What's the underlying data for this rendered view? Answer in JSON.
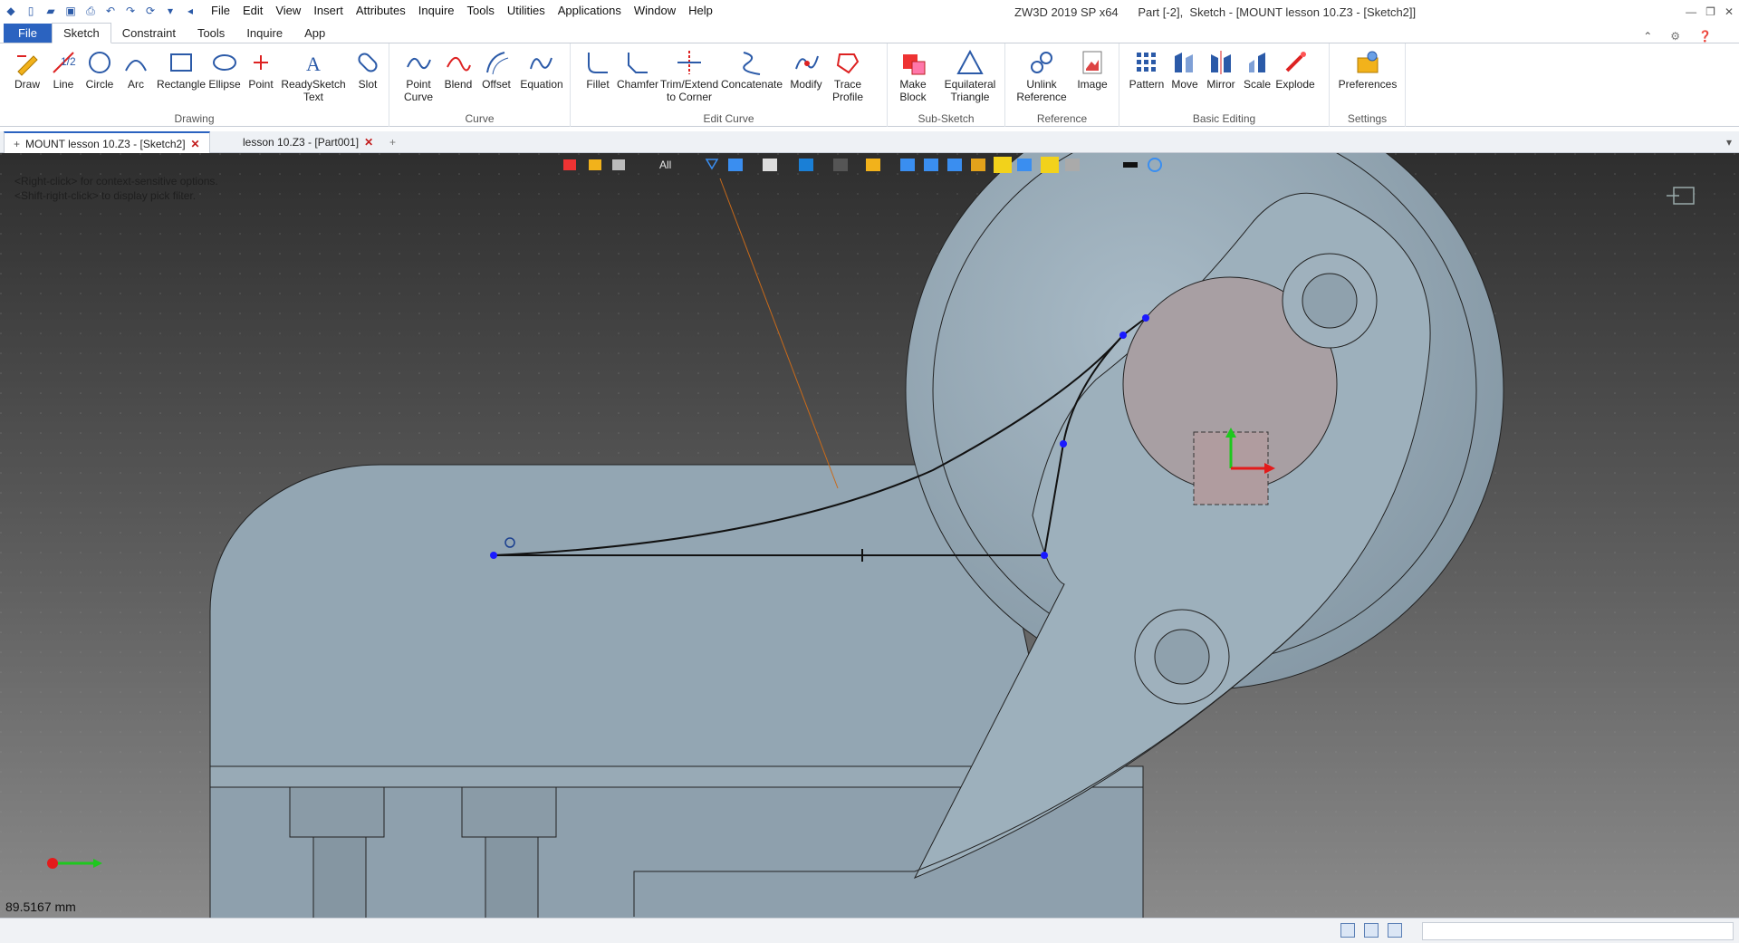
{
  "titlebar": {
    "menus": [
      "File",
      "Edit",
      "View",
      "Insert",
      "Attributes",
      "Inquire",
      "Tools",
      "Utilities",
      "Applications",
      "Window",
      "Help"
    ],
    "app_title": "ZW3D 2019 SP x64",
    "doc_title": "Part [-2],  Sketch - [MOUNT lesson 10.Z3 - [Sketch2]]"
  },
  "ribbon_tabs": [
    "File",
    "Sketch",
    "Constraint",
    "Tools",
    "Inquire",
    "App"
  ],
  "ribbon": {
    "groups": {
      "drawing": "Drawing",
      "curve": "Curve",
      "edit_curve": "Edit Curve",
      "sub_sketch": "Sub-Sketch",
      "reference": "Reference",
      "basic_editing": "Basic Editing",
      "settings": "Settings"
    },
    "tools": {
      "draw": "Draw",
      "line": "Line",
      "circle": "Circle",
      "arc": "Arc",
      "rectangle": "Rectangle",
      "ellipse": "Ellipse",
      "point": "Point",
      "readysketch": "ReadySketch\nText",
      "slot": "Slot",
      "point_curve": "Point\nCurve",
      "blend": "Blend",
      "offset": "Offset",
      "equation": "Equation",
      "fillet": "Fillet",
      "chamfer": "Chamfer",
      "trim": "Trim/Extend\nto Corner",
      "concatenate": "Concatenate",
      "modify": "Modify",
      "trace": "Trace\nProfile",
      "make_block": "Make\nBlock",
      "eq_triangle": "Equilateral\nTriangle",
      "unlink": "Unlink\nReference",
      "image": "Image",
      "pattern": "Pattern",
      "move": "Move",
      "mirror": "Mirror",
      "scale": "Scale",
      "explode": "Explode",
      "preferences": "Preferences"
    }
  },
  "doc_tabs": [
    {
      "label": "MOUNT lesson 10.Z3 - [Sketch2]",
      "active": true
    },
    {
      "label": "lesson 10.Z3 - [Part001]",
      "active": false
    }
  ],
  "viewport": {
    "hint1": "<Right-click> for context-sensitive options.",
    "hint2": "<Shift-right-click> to display pick filter.",
    "pick_filter": "All",
    "readout": "89.5167 mm"
  },
  "colors": {
    "accent": "#2b63c0",
    "part_fill": "#93a6b3",
    "sketch_point": "#1a1aff",
    "axis_x": "#e31b1b",
    "axis_y": "#1ec81e"
  }
}
